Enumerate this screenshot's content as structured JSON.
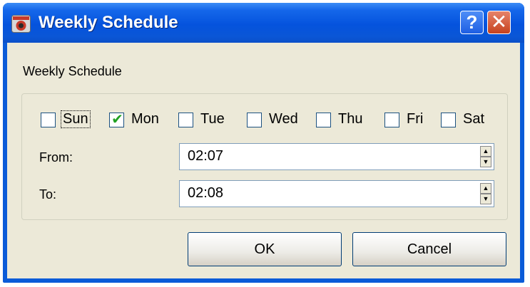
{
  "window": {
    "title": "Weekly Schedule",
    "help_glyph": "?",
    "close_glyph": "✕"
  },
  "group": {
    "label": "Weekly Schedule"
  },
  "days": [
    {
      "label": "Sun",
      "checked": false,
      "focused": true
    },
    {
      "label": "Mon",
      "checked": true,
      "focused": false
    },
    {
      "label": "Tue",
      "checked": false,
      "focused": false
    },
    {
      "label": "Wed",
      "checked": false,
      "focused": false
    },
    {
      "label": "Thu",
      "checked": false,
      "focused": false
    },
    {
      "label": "Fri",
      "checked": false,
      "focused": false
    },
    {
      "label": "Sat",
      "checked": false,
      "focused": false
    }
  ],
  "from": {
    "label": "From:",
    "value": "02:07"
  },
  "to": {
    "label": "To:",
    "value": "02:08"
  },
  "buttons": {
    "ok": "OK",
    "cancel": "Cancel"
  },
  "colors": {
    "titlebar": "#0553dd",
    "face": "#ece9d8",
    "check": "#21a121"
  }
}
